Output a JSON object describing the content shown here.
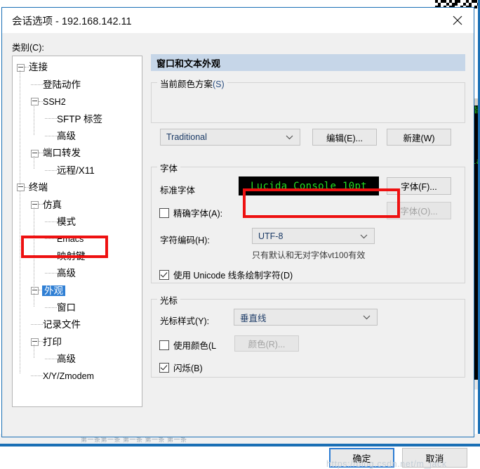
{
  "window": {
    "title": "会话选项 - 192.168.142.11",
    "close_icon": "close-icon"
  },
  "sidebar": {
    "label": "类别(C):",
    "items": [
      {
        "label": "连接",
        "depth": 0,
        "expandable": true,
        "selected": false
      },
      {
        "label": "登陆动作",
        "depth": 1,
        "expandable": false,
        "selected": false
      },
      {
        "label": "SSH2",
        "depth": 1,
        "expandable": true,
        "selected": false,
        "ascii": true
      },
      {
        "label": "SFTP 标签",
        "depth": 2,
        "expandable": false,
        "selected": false
      },
      {
        "label": "高级",
        "depth": 2,
        "expandable": false,
        "selected": false
      },
      {
        "label": "端口转发",
        "depth": 1,
        "expandable": true,
        "selected": false
      },
      {
        "label": "远程/X11",
        "depth": 2,
        "expandable": false,
        "selected": false
      },
      {
        "label": "终端",
        "depth": 0,
        "expandable": true,
        "selected": false
      },
      {
        "label": "仿真",
        "depth": 1,
        "expandable": true,
        "selected": false
      },
      {
        "label": "模式",
        "depth": 2,
        "expandable": false,
        "selected": false
      },
      {
        "label": "Emacs",
        "depth": 2,
        "expandable": false,
        "selected": false,
        "ascii": true
      },
      {
        "label": "映射键",
        "depth": 2,
        "expandable": false,
        "selected": false
      },
      {
        "label": "高级",
        "depth": 2,
        "expandable": false,
        "selected": false
      },
      {
        "label": "外观",
        "depth": 1,
        "expandable": true,
        "selected": true
      },
      {
        "label": "窗口",
        "depth": 2,
        "expandable": false,
        "selected": false
      },
      {
        "label": "记录文件",
        "depth": 1,
        "expandable": false,
        "selected": false
      },
      {
        "label": "打印",
        "depth": 1,
        "expandable": true,
        "selected": false
      },
      {
        "label": "高级",
        "depth": 2,
        "expandable": false,
        "selected": false
      },
      {
        "label": "X/Y/Zmodem",
        "depth": 1,
        "expandable": false,
        "selected": false,
        "ascii": true
      }
    ]
  },
  "panel": {
    "header": "窗口和文本外观",
    "color_scheme": {
      "group_title": "当前颜色方案",
      "group_mnemonic": "(S)",
      "value": "Traditional",
      "edit_button": "编辑(E)...",
      "new_button": "新建(W)"
    },
    "font": {
      "group_title": "字体",
      "normal_font_label": "标准字体",
      "sample_text": "Lucida Console 10pt",
      "font_button": "字体(F)...",
      "exact_font_label": "精确字体(A):",
      "exact_font_checked": false,
      "exact_font_button": "字体(O)...",
      "charset_label": "字符编码(H):",
      "charset_value": "UTF-8",
      "charset_hint": "只有默认和无对字体vt100有效",
      "unicode_line_label": "使用 Unicode 线条绘制字符(D)",
      "unicode_line_checked": true
    },
    "cursor": {
      "group_title": "光标",
      "style_label": "光标样式(Y):",
      "style_value": "垂直线",
      "use_color_label": "使用颜色(L",
      "use_color_checked": false,
      "color_button": "颜色(R)...",
      "blink_label": "闪烁(B)",
      "blink_checked": true
    }
  },
  "footer": {
    "ok": "确定",
    "cancel": "取消"
  },
  "background": {
    "watermark": "https://blog.csdn.net/m_jack",
    "bottom_caption": "第一条第一条  第一条  第一条 第一条",
    "terminal_lines": [
      "指",
      "la"
    ]
  },
  "colors": {
    "accent": "#2b7cd3",
    "panel_header": "#c6d6e8",
    "selection": "#2f7fd4",
    "annotation": "#ee1111",
    "terminal_green": "#22dd22"
  }
}
